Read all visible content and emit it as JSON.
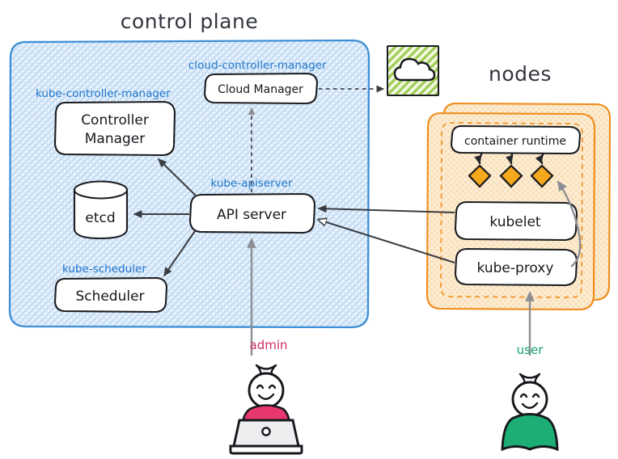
{
  "diagram": {
    "title_control_plane": "control plane",
    "title_nodes": "nodes"
  },
  "control_plane": {
    "annotations": {
      "kube_controller_manager": "kube-controller-manager",
      "cloud_controller_manager": "cloud-controller-manager",
      "kube_apiserver": "kube-apiserver",
      "kube_scheduler": "kube-scheduler"
    },
    "components": {
      "controller_manager_line1": "Controller",
      "controller_manager_line2": "Manager",
      "cloud_manager": "Cloud Manager",
      "api_server": "API server",
      "etcd": "etcd",
      "scheduler": "Scheduler"
    }
  },
  "nodes": {
    "components": {
      "container_runtime": "container runtime",
      "kubelet": "kubelet",
      "kube_proxy": "kube-proxy"
    },
    "pod_count": 3
  },
  "cloud": {
    "icon": "cloud-icon"
  },
  "actors": {
    "admin_label": "admin",
    "user_label": "user"
  },
  "colors": {
    "control_plane_border": "#3d8fd6",
    "control_plane_fill": "#e8f1fb",
    "nodes_border": "#f08c1a",
    "nodes_fill": "#fdecd2",
    "annotation_text": "#1f75cb",
    "admin_accent": "#e8376f",
    "admin_label": "#cf2e63",
    "user_accent": "#1cae75",
    "user_label": "#17a06a",
    "pod_fill": "#f5a81c",
    "cloud_hatch": "#8dc63f",
    "ink": "#16181d",
    "arrow_gray": "#8b8e94"
  }
}
